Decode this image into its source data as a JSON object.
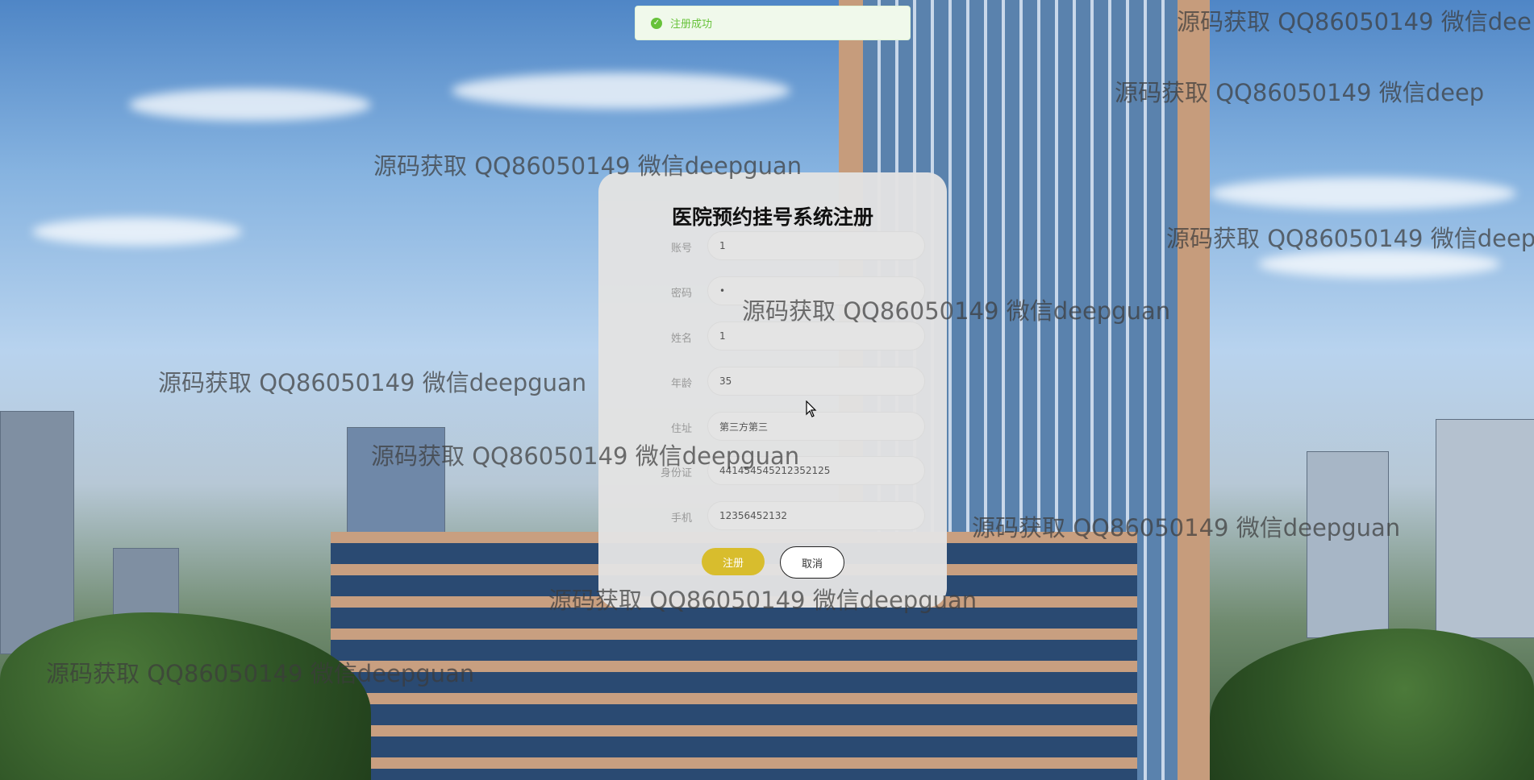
{
  "toast": {
    "message": "注册成功",
    "icon": "check-circle-icon",
    "color": "#67c23a"
  },
  "form": {
    "title": "医院预约挂号系统注册",
    "fields": [
      {
        "label": "账号",
        "value": "1"
      },
      {
        "label": "密码",
        "value": "•"
      },
      {
        "label": "姓名",
        "value": "1"
      },
      {
        "label": "年龄",
        "value": "35"
      },
      {
        "label": "住址",
        "value": "第三方第三"
      },
      {
        "label": "身份证",
        "value": "441454545212352125"
      },
      {
        "label": "手机",
        "value": "12356452132"
      }
    ],
    "register_label": "注册",
    "cancel_label": "取消",
    "register_color": "#d8bd2d"
  },
  "watermark": {
    "text": "源码获取 QQ86050149 微信deepguan",
    "text_cut1": "源码获取 QQ86050149 微信dee",
    "text_cut2": "源码获取 QQ86050149 微信deep"
  }
}
